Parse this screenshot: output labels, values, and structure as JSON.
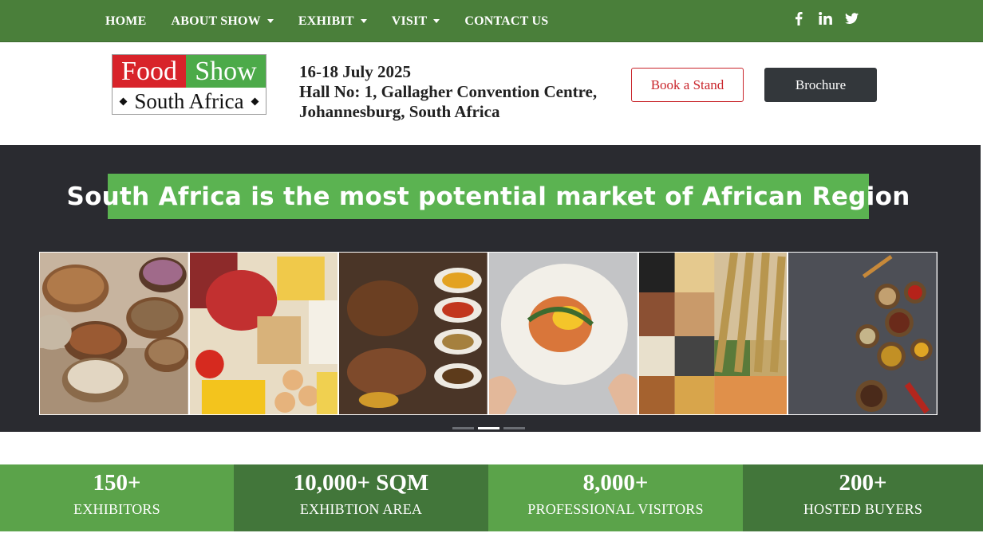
{
  "nav": {
    "items": [
      {
        "label": "HOME",
        "dropdown": false
      },
      {
        "label": "ABOUT SHOW",
        "dropdown": true
      },
      {
        "label": "EXHIBIT",
        "dropdown": true
      },
      {
        "label": "VISIT",
        "dropdown": true
      },
      {
        "label": "CONTACT US",
        "dropdown": false
      }
    ],
    "socials": [
      "facebook-icon",
      "linkedin-icon",
      "twitter-icon"
    ]
  },
  "logo": {
    "word1": "Food",
    "word2": "Show",
    "line2": "South Africa"
  },
  "event": {
    "dates": "16-18 July 2025",
    "venue": "Hall No: 1, Gallagher Convention Centre,",
    "city": "Johannesburg, South Africa"
  },
  "header_buttons": {
    "stand_label": "Book a Stand",
    "brochure_label": "Brochure"
  },
  "hero": {
    "banner": "South Africa is the most potential market of African Region",
    "photos": [
      "grains-bowls",
      "meat-bread-vegetables",
      "spices-dishes",
      "plated-dish",
      "grains-seeds-wheat",
      "spice-bowls"
    ],
    "slides": 3,
    "active_slide": 1
  },
  "stats": [
    {
      "number": "150+",
      "label": "EXHIBITORS"
    },
    {
      "number": "10,000+ SQM",
      "label": "EXHIBTION AREA"
    },
    {
      "number": "8,000+",
      "label": "PROFESSIONAL VISITORS"
    },
    {
      "number": "200+",
      "label": "HOSTED BUYERS"
    }
  ],
  "colors": {
    "nav_green": "#4a7f3a",
    "brand_red": "#d8232a",
    "brand_green": "#4caa49",
    "banner_green": "#5bb351",
    "hero_dark": "#2a2b30",
    "stat_light": "#5ba34a",
    "stat_dark": "#42763a"
  }
}
